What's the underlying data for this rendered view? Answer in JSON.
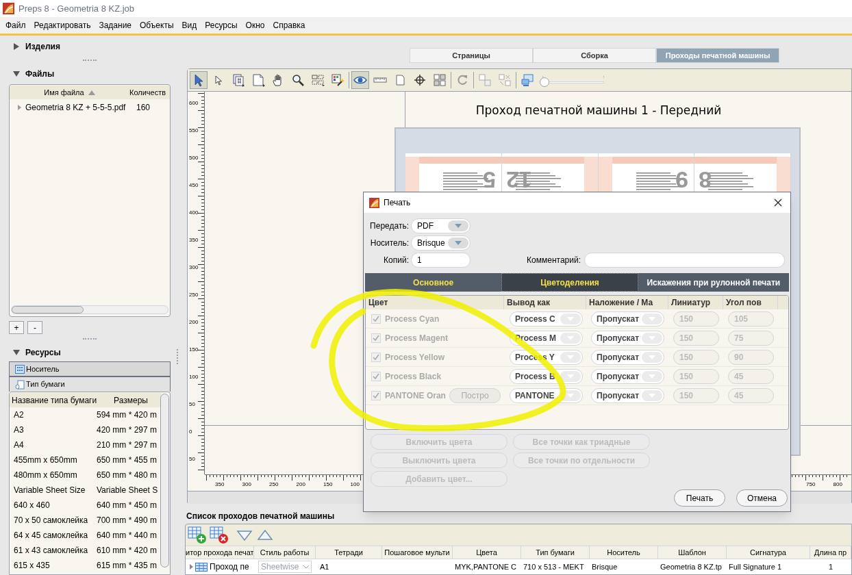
{
  "window": {
    "title": "Preps 8 - Geometria 8 KZ.job"
  },
  "menu": [
    "Файл",
    "Редактировать",
    "Задание",
    "Объекты",
    "Вид",
    "Ресурсы",
    "Окно",
    "Справка"
  ],
  "left_panel": {
    "products": {
      "label": "Изделия",
      "expanded": false
    },
    "files": {
      "label": "Файлы",
      "expanded": true,
      "columns": [
        "Имя файла",
        "Количеств"
      ],
      "rows": [
        {
          "name": "Geometria 8 KZ + 5-5-5.pdf",
          "count": "160",
          "expanded": false
        }
      ],
      "buttons": [
        "+",
        "-"
      ]
    },
    "resources": {
      "label": "Ресурсы",
      "expanded": true,
      "tabs": [
        {
          "label": "Носитель",
          "kind": "media",
          "selected": false
        },
        {
          "label": "Тип бумаги",
          "kind": "paper",
          "selected": true
        }
      ],
      "columns": [
        "Название типа бумаги",
        "Размеры"
      ],
      "rows": [
        [
          "A2",
          "594 mm * 420 m"
        ],
        [
          "A3",
          "420 mm * 297 m"
        ],
        [
          "A4",
          "210 mm * 297 m"
        ],
        [
          "455mm x 650mm",
          "650 mm * 455 m"
        ],
        [
          "480mm x 650mm",
          "650 mm * 480 m"
        ],
        [
          "Variable Sheet Size",
          "Variable Sheet S"
        ],
        [
          "640 x 460",
          "640 mm * 450 m"
        ],
        [
          "70 x 50 самоклейка",
          "700 mm * 490 m"
        ],
        [
          "64 x 45 самоклейка",
          "640 mm * 440 m"
        ],
        [
          "61 x 43 самоклейка",
          "610 mm * 420 m"
        ],
        [
          "615 x 435",
          "615 mm * 435 m"
        ]
      ]
    }
  },
  "view_tabs": [
    {
      "label": "Страницы",
      "selected": false
    },
    {
      "label": "Сборка",
      "selected": false
    },
    {
      "label": "Проходы печатной машины",
      "selected": true
    }
  ],
  "toolbar": {
    "tools": [
      {
        "kind": "pointer",
        "selected": true
      },
      {
        "kind": "arrow",
        "selected": false
      },
      {
        "kind": "page-number",
        "selected": false
      },
      {
        "kind": "page-menu",
        "selected": false
      },
      {
        "kind": "hand",
        "selected": false
      },
      {
        "kind": "zoom",
        "selected": false
      },
      {
        "kind": "grid-menu",
        "selected": false
      },
      {
        "kind": "magic",
        "selected": false
      },
      {
        "kind": "separator"
      },
      {
        "kind": "eye",
        "selected": true
      },
      {
        "kind": "ruler",
        "selected": false
      },
      {
        "kind": "page",
        "selected": false
      },
      {
        "kind": "crosshair",
        "selected": false
      },
      {
        "kind": "grid",
        "selected": false
      },
      {
        "kind": "separator"
      },
      {
        "kind": "rotate",
        "selected": false
      },
      {
        "kind": "separator"
      },
      {
        "kind": "align",
        "selected": false
      },
      {
        "kind": "split",
        "selected": false
      },
      {
        "kind": "separator"
      },
      {
        "kind": "monitor",
        "selected": false
      }
    ],
    "zoom_slider": {
      "level": 0
    }
  },
  "canvas": {
    "title": "Проход печатной машины 1 - Передний",
    "ruler_v": [
      "600",
      "550",
      "500",
      "450",
      "400",
      "350",
      "300",
      "250",
      "200",
      "150",
      "100",
      "50",
      "0",
      "50"
    ],
    "ruler_h": [
      "350",
      "300",
      "250",
      "200",
      "150",
      "100",
      "750",
      "800"
    ],
    "page_numbers": [
      "5",
      "12",
      "9",
      "8"
    ]
  },
  "print_dialog": {
    "title": "Печать",
    "fields": [
      {
        "label": "Передать:",
        "value": "PDF",
        "kind": "dropdown"
      },
      {
        "label": "Носитель:",
        "value": "Brisque",
        "kind": "dropdown"
      },
      {
        "label": "Копий:",
        "value": "1",
        "kind": "input"
      }
    ],
    "comment": {
      "label": "Комментарий:"
    },
    "tabs": [
      {
        "label": "Основное",
        "selected": false
      },
      {
        "label": "Цветоделения",
        "selected": true
      },
      {
        "label": "Искажения при рулонной печати",
        "selected": false
      }
    ],
    "columns": [
      "Цвет",
      "Вывод как",
      "Наложение / Ма",
      "Линиатур",
      "Угол пов"
    ],
    "rows": [
      {
        "name": "Process Cyan",
        "checked": true,
        "output": "Process C",
        "overprint": "Пропускат",
        "lpi": "150",
        "angle": "105"
      },
      {
        "name": "Process Magent",
        "checked": true,
        "output": "Process M",
        "overprint": "Пропускат",
        "lpi": "150",
        "angle": "75"
      },
      {
        "name": "Process Yellow",
        "checked": true,
        "output": "Process Y",
        "overprint": "Пропускат",
        "lpi": "150",
        "angle": "90"
      },
      {
        "name": "Process Black",
        "checked": true,
        "output": "Process B",
        "overprint": "Пропускат",
        "lpi": "150",
        "angle": "45"
      },
      {
        "name": "PANTONE Oran",
        "checked": true,
        "button": "Постро",
        "output": "PANTONE",
        "overprint": "Пропускат",
        "lpi": "150",
        "angle": "45"
      }
    ],
    "color_buttons": [
      {
        "label": "Включить цвета",
        "disabled": true
      },
      {
        "label": "Все точки как триадные",
        "disabled": true
      },
      {
        "label": "Выключить цвета",
        "disabled": true
      },
      {
        "label": "Все точки по отдельности",
        "disabled": true
      },
      {
        "label": "Добавить цвет...",
        "disabled": true
      }
    ],
    "actions": [
      "Печать",
      "Отмена"
    ]
  },
  "press_runs": {
    "title": "Список проходов печатной машины",
    "columns": [
      "итор прохода печат",
      "Стиль работы",
      "Тетради",
      "Пошаговое мульти",
      "Цвета",
      "Тип бумаги",
      "Носитель",
      "Шаблон",
      "Сигнатура",
      "Длина пр"
    ],
    "rows": [
      {
        "expanded": false,
        "cells": [
          "Проход пе",
          "Sheetwise",
          "A1",
          "",
          "MYK,PANTONE C",
          "710 x 513 - MEKT",
          "Brisque",
          "Geometria 8 KZ.tp",
          "Full Signature 1",
          "1"
        ]
      }
    ]
  }
}
